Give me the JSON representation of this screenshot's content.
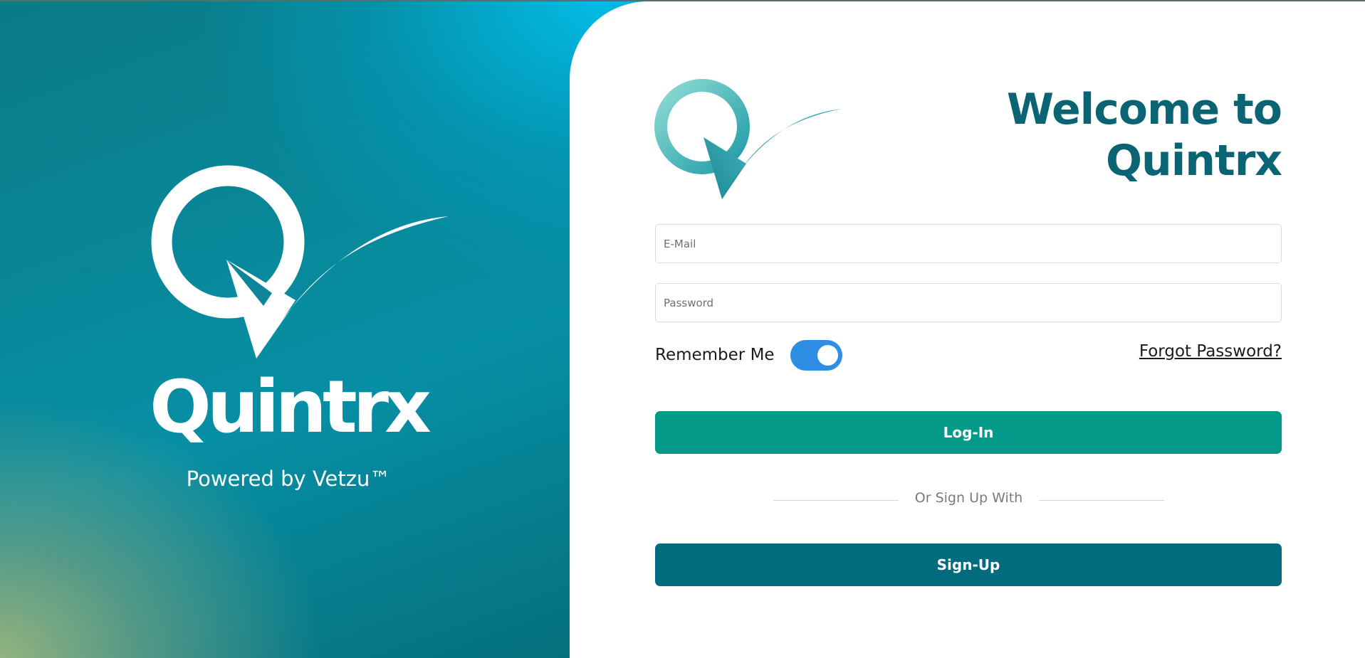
{
  "brand": {
    "name": "Quintrx",
    "tagline": "Powered by Vetzu™"
  },
  "form": {
    "welcome_line1": "Welcome to",
    "welcome_line2": "Quintrx",
    "email_placeholder": "E-Mail",
    "email_value": "",
    "password_placeholder": "Password",
    "password_value": "",
    "remember_label": "Remember Me",
    "remember_on": true,
    "forgot_label": "Forgot Password?",
    "login_label": "Log-In",
    "divider_text": "Or Sign Up With",
    "signup_label": "Sign-Up"
  },
  "icons": {
    "brand_logo": "q-check-logo-icon",
    "form_logo": "q-check-logo-icon"
  },
  "colors": {
    "heading": "#0b6473",
    "login_button": "#049a8a",
    "signup_button": "#036b7e",
    "toggle_on": "#2d8ee4"
  }
}
